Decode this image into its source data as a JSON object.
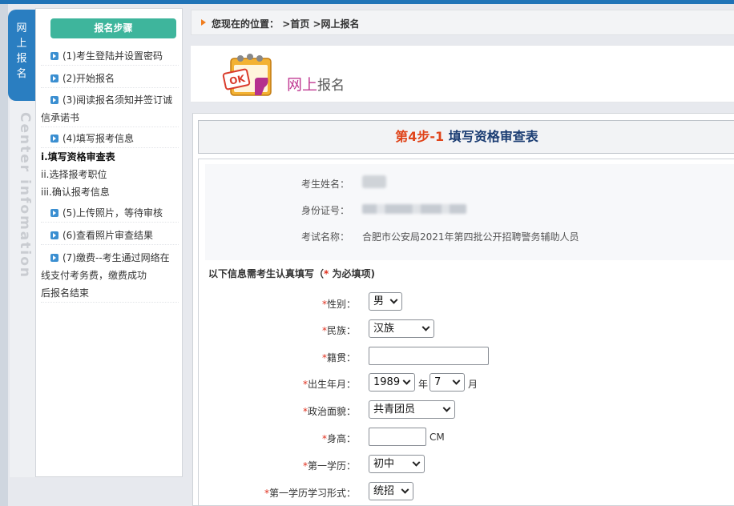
{
  "side_tab": {
    "chars": [
      "网",
      "上",
      "报",
      "名"
    ],
    "english": "Center infomation"
  },
  "sidebar": {
    "header": "报名步骤",
    "steps": [
      {
        "label": "(1)考生登陆并设置密码"
      },
      {
        "label": "(2)开始报名"
      },
      {
        "label": "(3)阅读报名须知并签订诚",
        "cont": "信承诺书"
      },
      {
        "label": "(4)填写报考信息"
      },
      {
        "label": "(5)上传照片，等待审核"
      },
      {
        "label": "(6)查看照片审查结果"
      },
      {
        "label": "(7)缴费--考生通过网络在",
        "cont": "线支付考务费，缴费成功",
        "cont2": "后报名结束"
      }
    ],
    "substeps": [
      "i.填写资格审查表",
      "ii.选择报考职位",
      "iii.确认报考信息"
    ]
  },
  "breadcrumb": {
    "prefix": "您现在的位置：",
    "home": ">首页",
    "current": ">网上报名"
  },
  "banner": {
    "title_a": "网上",
    "title_b": "报名",
    "ok_text": "OK"
  },
  "step": {
    "num": "第4步-1",
    "title": "填写资格审查表"
  },
  "info": {
    "name_label": "考生姓名：",
    "id_label": "身份证号：",
    "exam_label": "考试名称：",
    "exam_value": "合肥市公安局2021年第四批公开招聘警务辅助人员"
  },
  "notice": {
    "text_a": "以下信息需考生认真填写（",
    "star": "*",
    "text_b": " 为必填项)"
  },
  "form": {
    "gender": {
      "label": "性别：",
      "value": "男"
    },
    "ethnicity": {
      "label": "民族：",
      "value": "汉族"
    },
    "native_place": {
      "label": "籍贯：",
      "value": ""
    },
    "birth": {
      "label": "出生年月：",
      "year": "1989",
      "year_unit": "年",
      "month": "7",
      "month_unit": "月"
    },
    "politics": {
      "label": "政治面貌：",
      "value": "共青团员"
    },
    "height": {
      "label": "身高：",
      "value": "",
      "unit": "CM"
    },
    "edu1": {
      "label": "第一学历：",
      "value": "初中"
    },
    "edu1_form": {
      "label": "第一学历学习形式：",
      "value": "统招"
    }
  },
  "colors": {
    "accent": "#2a7ec1",
    "header_green": "#3eb59c",
    "required": "#e0301e",
    "step_num": "#e0451b",
    "step_title": "#1b3d73",
    "banner_title": "#c03a93"
  }
}
